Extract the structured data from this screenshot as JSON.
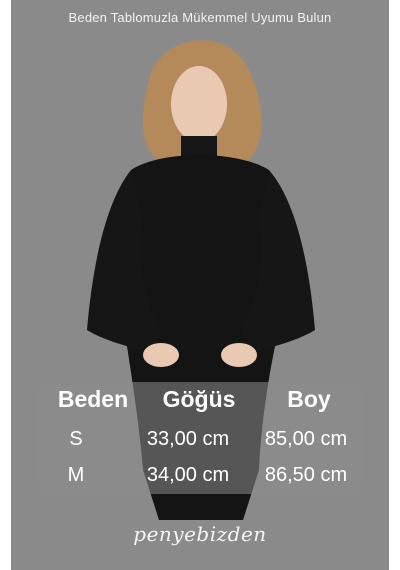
{
  "header": {
    "title": "Beden Tablomuzla Mükemmel Uyumu Bulun"
  },
  "size_table": {
    "headers": [
      "Beden",
      "Göğüs",
      "Boy"
    ],
    "rows": [
      {
        "size": "S",
        "chest": "33,00 cm",
        "length": "85,00 cm"
      },
      {
        "size": "M",
        "chest": "34,00 cm",
        "length": "86,50 cm"
      }
    ]
  },
  "brand": {
    "name": "penyebizden"
  },
  "colors": {
    "background": "#8a8a8a",
    "dress": "#141414",
    "text": "#ffffff"
  }
}
